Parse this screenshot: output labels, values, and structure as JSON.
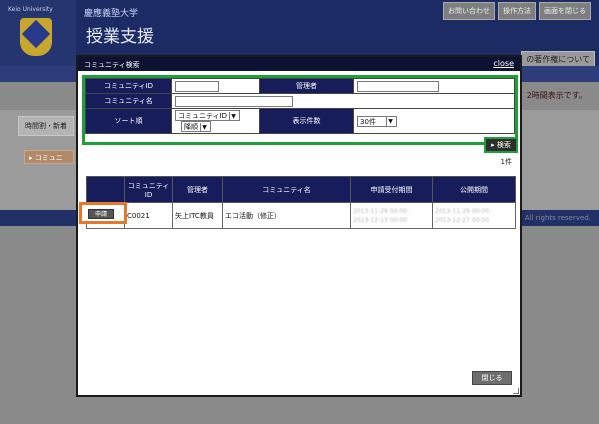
{
  "background": {
    "univ_en": "Keio University",
    "univ_jp": "慶應義塾大学",
    "system_title": "授業支援",
    "top_buttons": [
      "お問い合わせ",
      "操作方法",
      "画面を閉じる"
    ],
    "copyright_tab": "の著作権について",
    "note": "2時間表示です。",
    "tab_label": "時間割・新着",
    "community_button": "▸ コミュニ",
    "footer_text": "y. All rights reserved."
  },
  "modal": {
    "title": "コミュニティ検索",
    "close_label": "close",
    "search": {
      "labels": {
        "community_id": "コミュニティID",
        "admin": "管理者",
        "community_name": "コミュニティ名",
        "sort": "ソート順",
        "page_size": "表示件数"
      },
      "values": {
        "community_id": "",
        "admin": "",
        "community_name": "",
        "sort_field": "コミュニティID",
        "sort_order": "降順",
        "page_size": "30件"
      },
      "button_label": "▸ 検索"
    },
    "result_count": "1件",
    "table": {
      "headers": [
        "",
        "コミュニティID",
        "管理者",
        "コミュニティ名",
        "申請受付期間",
        "公開期間"
      ],
      "rows": [
        {
          "action": "申請",
          "id": "C0021",
          "admin": "矢上ITC教員",
          "name": "エコ活動（修正）",
          "apply_period_start": "2013-11-29 00:00 -",
          "apply_period_end": "2013-12-13 00:00",
          "public_period_start": "2013-11-29 00:00 -",
          "public_period_end": "2013-12-27 00:00"
        }
      ]
    },
    "close_button": "閉じる"
  },
  "colors": {
    "header_navy": "#1c2b63",
    "label_navy": "#171d5b",
    "highlight_green": "#1f9f3a",
    "highlight_orange": "#e6772b"
  }
}
